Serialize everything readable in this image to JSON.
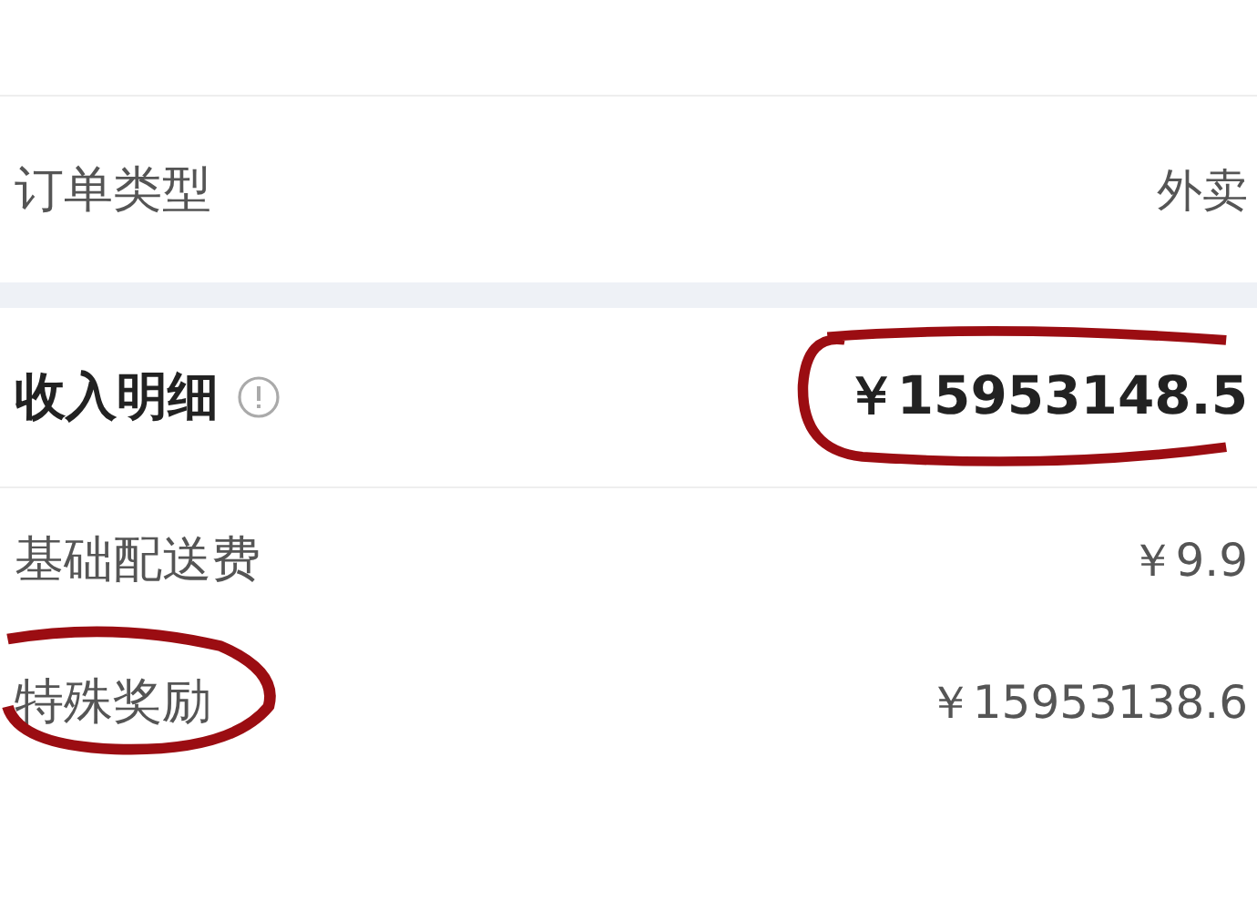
{
  "order_type": {
    "label": "订单类型",
    "value": "外卖"
  },
  "income": {
    "label": "收入明细",
    "value": "￥15953148.5",
    "value_circled": true
  },
  "items": [
    {
      "label": "基础配送费",
      "value": "￥9.9",
      "label_circled": false
    },
    {
      "label": "特殊奖励",
      "value": "￥15953138.6",
      "label_circled": true
    }
  ]
}
